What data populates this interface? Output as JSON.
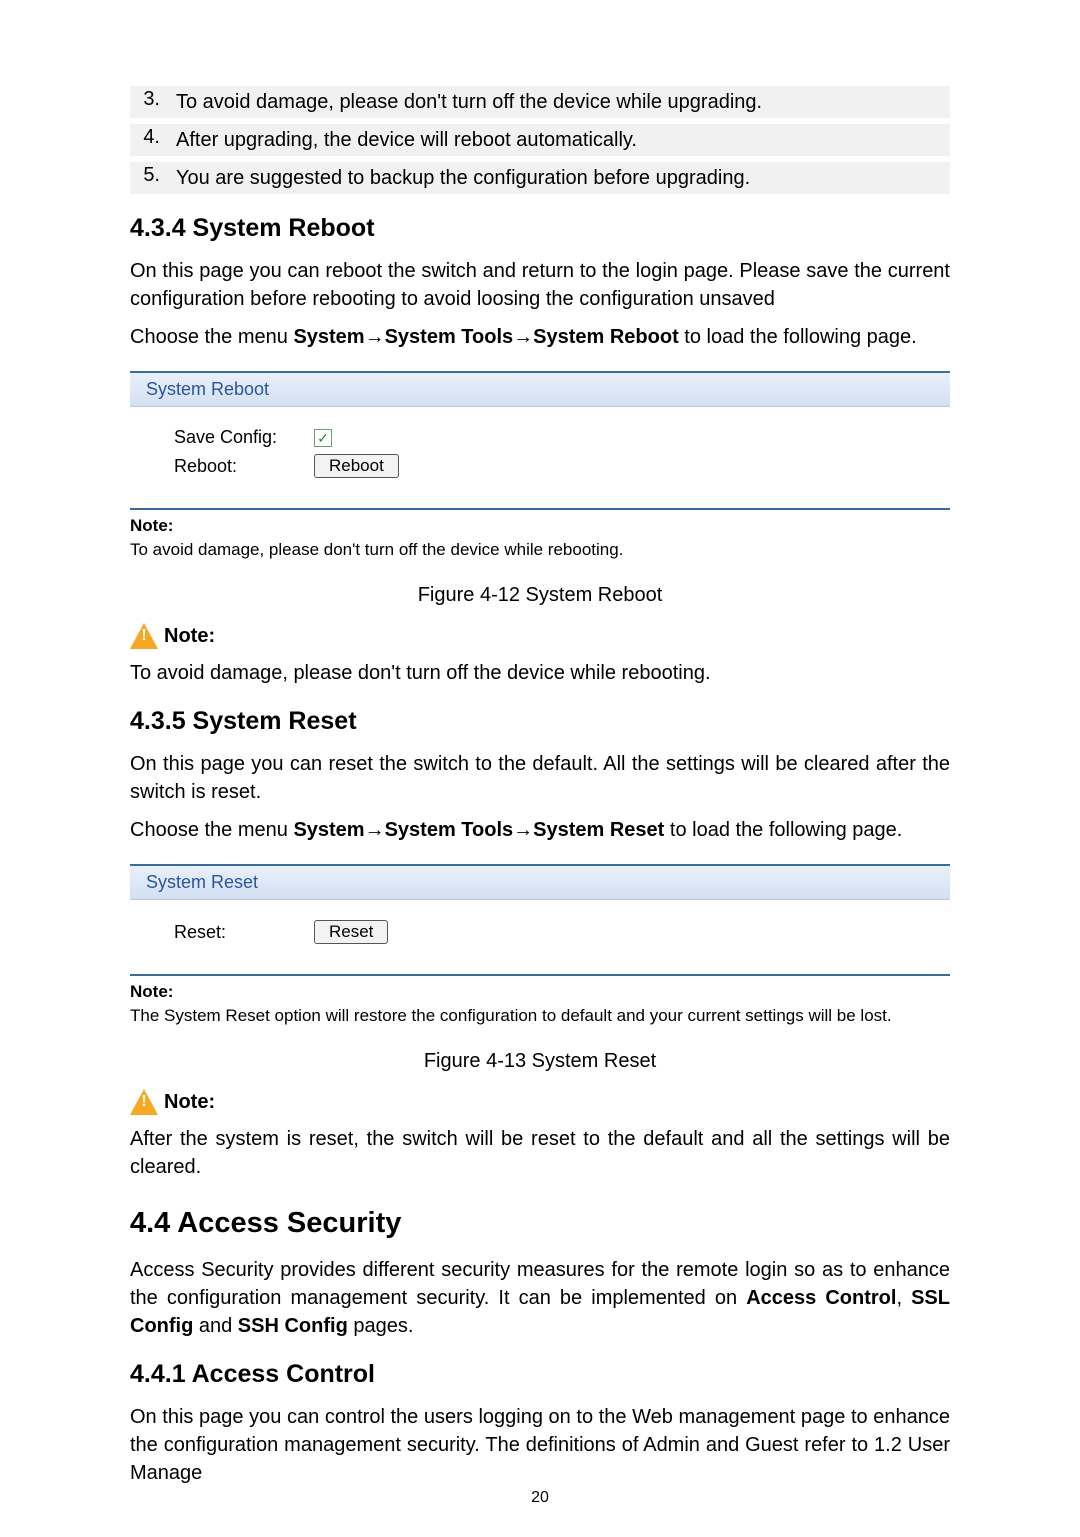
{
  "list": {
    "items": [
      {
        "num": "3.",
        "text": "To avoid damage, please don't turn off the device while upgrading."
      },
      {
        "num": "4.",
        "text": "After upgrading, the device will reboot automatically."
      },
      {
        "num": "5.",
        "text": "You are suggested to backup the configuration before upgrading."
      }
    ]
  },
  "reboot": {
    "heading": "4.3.4 System Reboot",
    "intro": "On this page you can reboot the switch and return to the login page. Please save the current configuration before rebooting to avoid loosing the configuration unsaved",
    "menu_prefix": "Choose the menu ",
    "menu_path_1": "System",
    "menu_path_2": "System Tools",
    "menu_path_3": "System Reboot",
    "menu_suffix": " to load the following page.",
    "panel_title": "System Reboot",
    "save_label": "Save Config:",
    "reboot_label": "Reboot:",
    "reboot_btn": "Reboot",
    "fig_note_title": "Note:",
    "fig_note_body": "To avoid damage, please don't turn off the device while rebooting.",
    "caption": "Figure 4-12 System Reboot",
    "note_label": "Note:",
    "note_body": "To avoid damage, please don't turn off the device while rebooting."
  },
  "reset": {
    "heading": "4.3.5 System Reset",
    "intro": "On this page you can reset the switch to the default. All the settings will be cleared after the switch is reset.",
    "menu_prefix": "Choose the menu ",
    "menu_path_1": "System",
    "menu_path_2": "System Tools",
    "menu_path_3": "System Reset",
    "menu_suffix": " to load the following page.",
    "panel_title": "System Reset",
    "reset_label": "Reset:",
    "reset_btn": "Reset",
    "fig_note_title": "Note:",
    "fig_note_body": "The System Reset option will restore the configuration to default and your current settings will be lost.",
    "caption": "Figure 4-13 System Reset",
    "note_label": "Note:",
    "note_body": "After the system is reset, the switch will be reset to the default and all the settings will be cleared."
  },
  "access": {
    "heading": "4.4   Access Security",
    "intro_pre": "Access Security provides different security measures for the remote login so as to enhance the configuration management security. It can be implemented on ",
    "b1": "Access Control",
    "sep1": ", ",
    "b2": "SSL Config",
    "sep2": " and ",
    "b3": "SSH Config",
    "intro_post": " pages.",
    "sub_heading": "4.4.1 Access Control",
    "sub_intro": "On this page you can control the users logging on to the Web management page to enhance the configuration management security. The definitions of Admin and Guest refer to 1.2 User Manage"
  },
  "arrow": "→",
  "checkbox_mark": "✓",
  "page_number": "20"
}
